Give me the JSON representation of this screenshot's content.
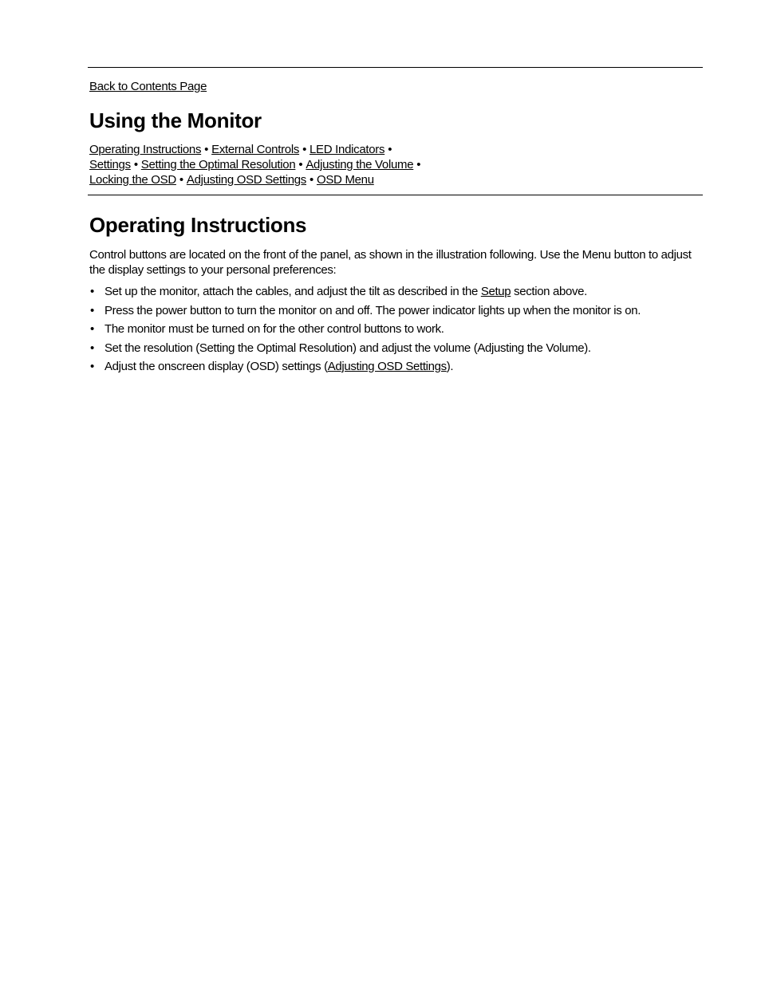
{
  "back_link": "Back to Contents Page",
  "title": "Using the Monitor",
  "nav": {
    "separator": "•",
    "lines": [
      [
        "Operating Instructions",
        "External Controls",
        "LED Indicators"
      ],
      [
        "Settings",
        "Setting the Optimal Resolution",
        "Adjusting the Volume"
      ],
      [
        "Locking the OSD",
        "Adjusting OSD Settings",
        "OSD Menu"
      ]
    ]
  },
  "section": {
    "title": "Operating Instructions",
    "intro": "Control buttons are located on the front of the panel, as shown in the illustration following. Use the Menu button to adjust the display settings to your personal preferences:",
    "bullet_glyph": "•",
    "bullets": [
      {
        "before": "Set up the monitor, attach the cables, and adjust the tilt as described in the ",
        "link": "Setup",
        "after": " section above."
      },
      {
        "before": "Press the power button to turn the monitor on and off. The power indicator lights up when the monitor is on.",
        "link": null,
        "after": ""
      },
      {
        "before": "The monitor must be turned on for the other control buttons to work.",
        "link": null,
        "after": ""
      },
      {
        "before": "Set the resolution (Setting the Optimal Resolution) and adjust the volume (Adjusting the Volume).",
        "link": null,
        "after": ""
      },
      {
        "before": "Adjust the onscreen display (OSD) settings (",
        "link": "Adjusting OSD Settings",
        "after": ")."
      }
    ]
  }
}
